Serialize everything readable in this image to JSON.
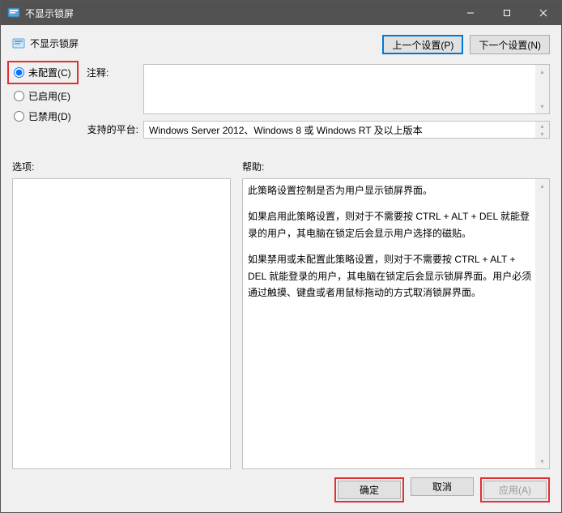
{
  "titlebar": {
    "title": "不显示锁屏"
  },
  "header": {
    "title": "不显示锁屏"
  },
  "nav": {
    "prev": "上一个设置(P)",
    "next": "下一个设置(N)"
  },
  "radios": {
    "not_configured": "未配置(C)",
    "enabled": "已启用(E)",
    "disabled": "已禁用(D)"
  },
  "fields": {
    "comment_label": "注释:",
    "platform_label": "支持的平台:",
    "platform_value": "Windows Server 2012、Windows 8 或 Windows RT 及以上版本"
  },
  "sections": {
    "options_label": "选项:",
    "help_label": "帮助:"
  },
  "help": {
    "p1": "此策略设置控制是否为用户显示锁屏界面。",
    "p2": "如果启用此策略设置，则对于不需要按 CTRL + ALT + DEL  就能登录的用户，其电脑在锁定后会显示用户选择的磁贴。",
    "p3": "如果禁用或未配置此策略设置，则对于不需要按 CTRL + ALT + DEL 就能登录的用户，其电脑在锁定后会显示锁屏界面。用户必须通过触摸、键盘或者用鼠标拖动的方式取消锁屏界面。"
  },
  "footer": {
    "ok": "确定",
    "cancel": "取消",
    "apply": "应用(A)"
  }
}
